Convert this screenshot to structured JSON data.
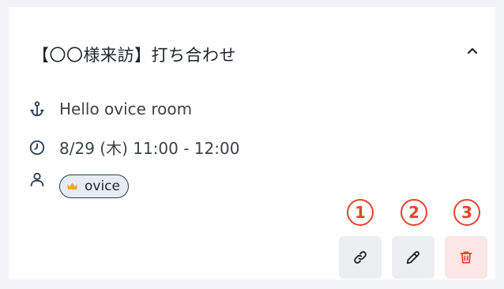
{
  "event": {
    "title": "【〇〇様来訪】打ち合わせ",
    "location": "Hello ovice room",
    "datetime": "8/29 (木) 11:00 - 12:00",
    "participants": [
      {
        "name": "ovice",
        "role_icon": "crown-icon"
      }
    ]
  },
  "annotations": [
    "1",
    "2",
    "3"
  ],
  "actions": [
    {
      "name": "copy-link",
      "icon": "link-icon"
    },
    {
      "name": "edit",
      "icon": "pencil-icon"
    },
    {
      "name": "delete",
      "icon": "trash-icon"
    }
  ],
  "colors": {
    "icon_blue": "#2a3c57",
    "annotation_red": "#e5432b",
    "crown_gold": "#f0a81f",
    "delete_bg": "#fbe7e5",
    "button_bg": "#eceef2"
  }
}
